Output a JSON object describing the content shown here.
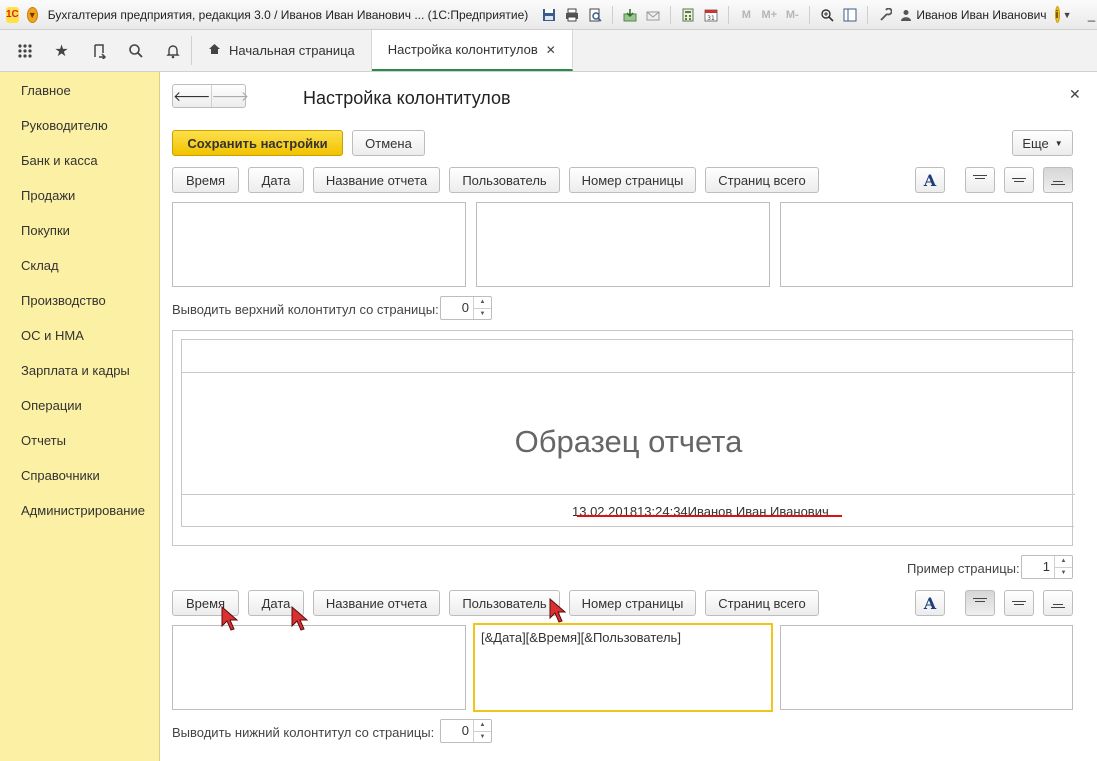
{
  "window": {
    "logo_text": "1С",
    "title": "Бухгалтерия предприятия, редакция 3.0 / Иванов Иван Иванович ... (1С:Предприятие)",
    "user": "Иванов Иван Иванович",
    "toolbar_icons": [
      "save-icon",
      "print-icon",
      "print-preview-icon",
      "favorites-add-icon",
      "mail-icon",
      "calculator-icon",
      "calendar-icon"
    ],
    "memory_buttons": [
      "M",
      "M+",
      "M-"
    ],
    "calendar_day": "31",
    "win_controls": {
      "minimize": "_",
      "maximize": "□",
      "close": "✕"
    }
  },
  "nav": {
    "tabs": [
      {
        "label": "Начальная страница"
      },
      {
        "label": "Настройка колонтитулов"
      }
    ],
    "close_glyph": "✕"
  },
  "sidebar": {
    "items": [
      {
        "label": "Главное"
      },
      {
        "label": "Руководителю"
      },
      {
        "label": "Банк и касса"
      },
      {
        "label": "Продажи"
      },
      {
        "label": "Покупки"
      },
      {
        "label": "Склад"
      },
      {
        "label": "Производство"
      },
      {
        "label": "ОС и НМА"
      },
      {
        "label": "Зарплата и кадры"
      },
      {
        "label": "Операции"
      },
      {
        "label": "Отчеты"
      },
      {
        "label": "Справочники"
      },
      {
        "label": "Администрирование"
      }
    ]
  },
  "form": {
    "title": "Настройка колонтитулов",
    "save_label": "Сохранить настройки",
    "cancel_label": "Отмена",
    "more_label": "Еще",
    "insert_buttons": [
      "Время",
      "Дата",
      "Название отчета",
      "Пользователь",
      "Номер страницы",
      "Страниц всего"
    ],
    "header_from_page_label": "Выводить верхний колонтитул со страницы:",
    "header_from_page_value": "0",
    "sample_title": "Образец отчета",
    "sample_footer": "13.02.201813:24:34Иванов Иван Иванович",
    "sample_page_label": "Пример страницы:",
    "sample_page_value": "1",
    "footer_center_text": "[&Дата][&Время][&Пользователь]",
    "footer_from_page_label": "Выводить нижний колонтитул со страницы:",
    "footer_from_page_value": "0",
    "font_button": "A"
  }
}
